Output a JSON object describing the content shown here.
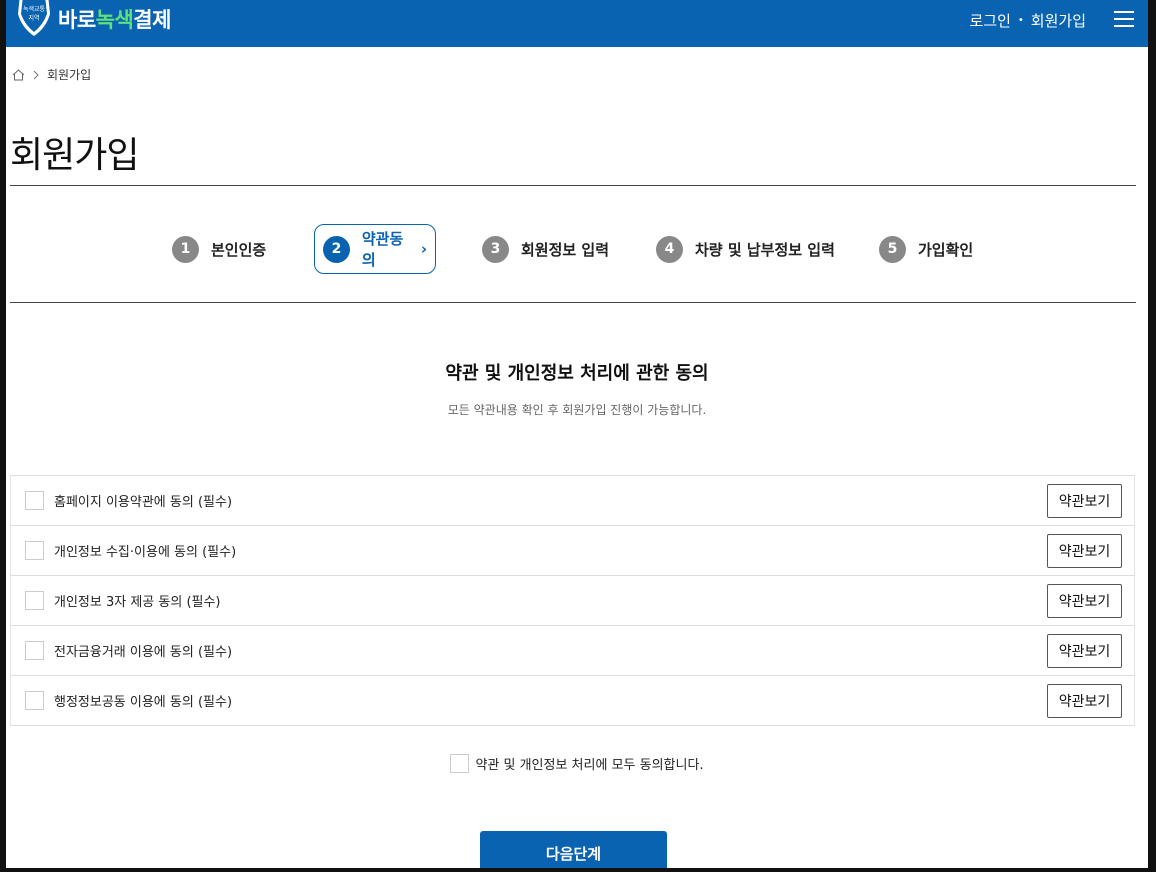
{
  "header": {
    "logo_badge_text_line1": "녹색교통",
    "logo_badge_text_line2": "지역",
    "logo_text_part1": "바로",
    "logo_text_part2": "녹색",
    "logo_text_part3": "결제",
    "login_label": "로그인",
    "separator": "•",
    "signup_label": "회원가입",
    "menu_icon": "hamburger-menu-icon"
  },
  "breadcrumb": {
    "home_icon": "home-icon",
    "separator_icon": "chevron-right-icon",
    "current": "회원가입"
  },
  "page_title": "회원가입",
  "steps": [
    {
      "num": "1",
      "label": "본인인증",
      "active": false
    },
    {
      "num": "2",
      "label": "약관동의",
      "active": true,
      "suffix": "›"
    },
    {
      "num": "3",
      "label": "회원정보 입력",
      "active": false
    },
    {
      "num": "4",
      "label": "차량 및 납부정보 입력",
      "active": false
    },
    {
      "num": "5",
      "label": "가입확인",
      "active": false
    }
  ],
  "section": {
    "title": "약관 및 개인정보 처리에 관한 동의",
    "subtitle": "모든 약관내용 확인 후 회원가입 진행이 가능합니다."
  },
  "terms": [
    {
      "label": "홈페이지 이용약관에 동의 (필수)",
      "button": "약관보기",
      "checked": false
    },
    {
      "label": "개인정보 수집·이용에 동의 (필수)",
      "button": "약관보기",
      "checked": false
    },
    {
      "label": "개인정보 3자 제공 동의 (필수)",
      "button": "약관보기",
      "checked": false
    },
    {
      "label": "전자금융거래 이용에 동의 (필수)",
      "button": "약관보기",
      "checked": false
    },
    {
      "label": "행정정보공동 이용에 동의 (필수)",
      "button": "약관보기",
      "checked": false
    }
  ],
  "agree_all": {
    "label": "약관 및 개인정보 처리에 모두 동의합니다.",
    "checked": false
  },
  "next_button": "다음단계",
  "colors": {
    "brand_blue": "#0a63b0",
    "logo_green": "#5fe07a",
    "step_inactive": "#888888"
  }
}
